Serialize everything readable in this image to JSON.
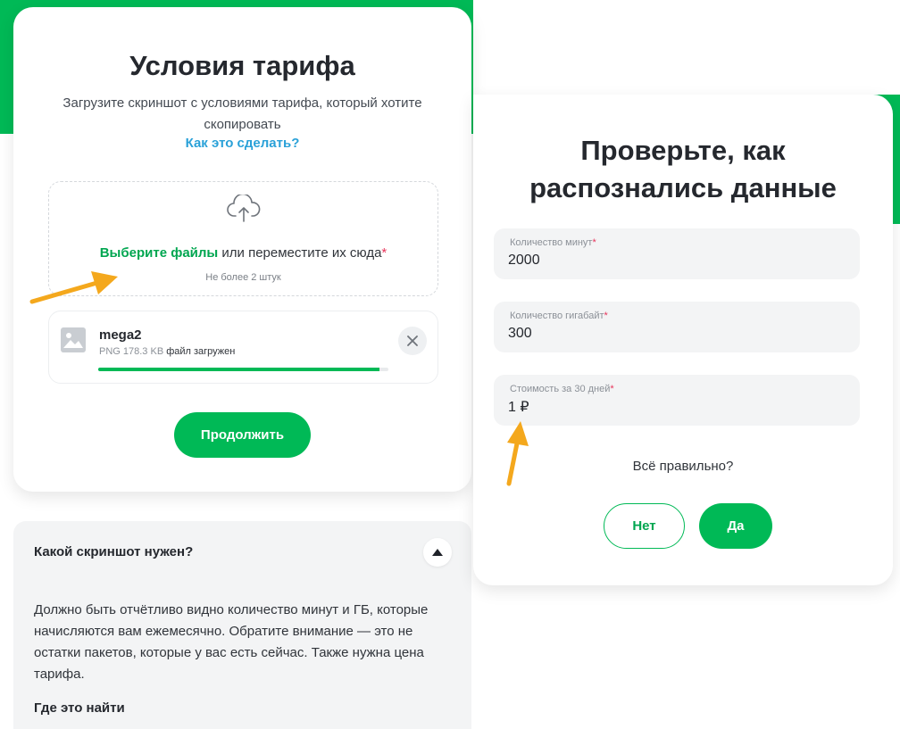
{
  "colors": {
    "brand_green": "#00b956",
    "link_blue": "#2aa1d8",
    "required_red": "#e7355b",
    "annotation_orange": "#f4a81d"
  },
  "upload_card": {
    "title": "Условия тарифа",
    "subtitle": "Загрузите скриншот с условиями тарифа, который хотите скопировать",
    "howto_link": "Как это сделать?",
    "dropzone": {
      "icon": "cloud-upload-icon",
      "choose_label": "Выберите файлы",
      "drag_label": " или переместите их сюда",
      "required_mark": "*",
      "limit_label": "Не более 2 штук"
    },
    "file": {
      "icon": "image-icon",
      "name": "mega2",
      "meta": "PNG 178.3 KB",
      "status": "файл загружен",
      "progress_percent": 100,
      "remove_icon": "close-icon"
    },
    "continue_label": "Продолжить"
  },
  "faq": {
    "question": "Какой скриншот нужен?",
    "toggle_icon": "caret-up-icon",
    "answer": "Должно быть отчётливо видно количество минут и ГБ, которые начисляются вам ежемесячно. Обратите внимание — это не остатки пакетов, которые у вас есть сейчас. Также нужна цена тарифа.",
    "where_label": "Где это найти"
  },
  "verify_card": {
    "title_line1": "Проверьте, как",
    "title_line2": "распознались данные",
    "fields": [
      {
        "label": "Количество минут",
        "required": "*",
        "value": "2000"
      },
      {
        "label": "Количество гигабайт",
        "required": "*",
        "value": "300"
      },
      {
        "label": "Стоимость за 30 дней",
        "required": "*",
        "value": "1 ₽"
      }
    ],
    "confirm_question": "Всё правильно?",
    "no_label": "Нет",
    "yes_label": "Да"
  }
}
